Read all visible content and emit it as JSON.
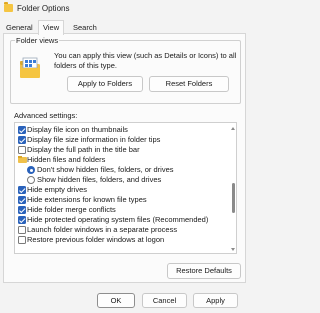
{
  "window": {
    "title": "Folder Options"
  },
  "tabs": [
    {
      "label": "General",
      "active": false
    },
    {
      "label": "View",
      "active": true
    },
    {
      "label": "Search",
      "active": false
    }
  ],
  "folder_views": {
    "legend": "Folder views",
    "description": "You can apply this view (such as Details or Icons) to all folders of this type.",
    "apply_button": "Apply to Folders",
    "reset_button": "Reset Folders"
  },
  "advanced": {
    "label": "Advanced settings:",
    "items": [
      {
        "type": "checkbox",
        "checked": true,
        "label": "Display file icon on thumbnails"
      },
      {
        "type": "checkbox",
        "checked": true,
        "label": "Display file size information in folder tips"
      },
      {
        "type": "checkbox",
        "checked": false,
        "label": "Display the full path in the title bar"
      },
      {
        "type": "folder",
        "label": "Hidden files and folders"
      },
      {
        "type": "radio",
        "checked": true,
        "label": "Don't show hidden files, folders, or drives"
      },
      {
        "type": "radio",
        "checked": false,
        "label": "Show hidden files, folders, and drives"
      },
      {
        "type": "checkbox",
        "checked": true,
        "label": "Hide empty drives"
      },
      {
        "type": "checkbox",
        "checked": true,
        "label": "Hide extensions for known file types"
      },
      {
        "type": "checkbox",
        "checked": true,
        "label": "Hide folder merge conflicts"
      },
      {
        "type": "checkbox",
        "checked": true,
        "label": "Hide protected operating system files (Recommended)"
      },
      {
        "type": "checkbox",
        "checked": false,
        "label": "Launch folder windows in a separate process"
      },
      {
        "type": "checkbox",
        "checked": false,
        "label": "Restore previous folder windows at logon"
      }
    ],
    "restore_button": "Restore Defaults"
  },
  "footer": {
    "ok": "OK",
    "cancel": "Cancel",
    "apply": "Apply"
  },
  "colors": {
    "accent": "#2a62bb",
    "folder": "#f0c14b"
  }
}
